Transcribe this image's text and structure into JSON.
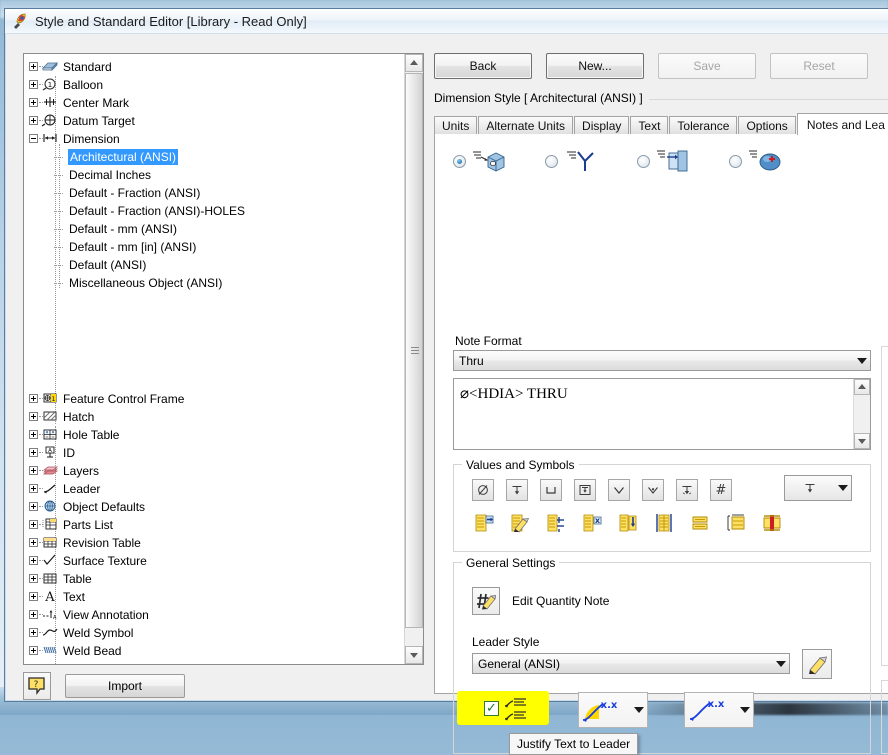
{
  "window": {
    "title": "Style and Standard Editor [Library - Read Only]",
    "icon": "style-editor-icon"
  },
  "tree": {
    "roots": [
      {
        "label": "Standard",
        "icon": "standard-book-icon",
        "expanded": false
      },
      {
        "label": "Balloon",
        "icon": "balloon-icon",
        "expanded": false
      },
      {
        "label": "Center Mark",
        "icon": "center-mark-icon",
        "expanded": false
      },
      {
        "label": "Datum Target",
        "icon": "datum-target-icon",
        "expanded": false
      },
      {
        "label": "Dimension",
        "icon": "dimension-icon",
        "expanded": true
      }
    ],
    "dimension_children": [
      {
        "label": "Architectural (ANSI)",
        "selected": true
      },
      {
        "label": "Decimal Inches",
        "selected": false
      },
      {
        "label": "Default - Fraction (ANSI)",
        "selected": false
      },
      {
        "label": "Default - Fraction (ANSI)-HOLES",
        "selected": false
      },
      {
        "label": "Default - mm (ANSI)",
        "selected": false
      },
      {
        "label": "Default - mm [in] (ANSI)",
        "selected": false
      },
      {
        "label": "Default (ANSI)",
        "selected": false
      },
      {
        "label": "Miscellaneous Object (ANSI)",
        "selected": false
      }
    ],
    "roots_lower": [
      {
        "label": "Feature Control Frame",
        "icon": "feature-control-frame-icon"
      },
      {
        "label": "Hatch",
        "icon": "hatch-icon"
      },
      {
        "label": "Hole Table",
        "icon": "hole-table-icon"
      },
      {
        "label": "ID",
        "icon": "id-icon"
      },
      {
        "label": "Layers",
        "icon": "layers-icon"
      },
      {
        "label": "Leader",
        "icon": "leader-icon"
      },
      {
        "label": "Object Defaults",
        "icon": "object-defaults-icon"
      },
      {
        "label": "Parts List",
        "icon": "parts-list-icon"
      },
      {
        "label": "Revision Table",
        "icon": "revision-table-icon"
      },
      {
        "label": "Surface Texture",
        "icon": "surface-texture-icon"
      },
      {
        "label": "Table",
        "icon": "table-icon"
      },
      {
        "label": "Text",
        "icon": "text-icon"
      },
      {
        "label": "View Annotation",
        "icon": "view-annotation-icon"
      },
      {
        "label": "Weld Symbol",
        "icon": "weld-symbol-icon"
      },
      {
        "label": "Weld Bead",
        "icon": "weld-bead-icon"
      }
    ]
  },
  "toolbar": {
    "back_label": "Back",
    "new_label": "New...",
    "save_label": "Save",
    "reset_label": "Reset"
  },
  "style_header": "Dimension Style [ Architectural (ANSI) ]",
  "tabs": [
    {
      "label": "Units",
      "active": false
    },
    {
      "label": "Alternate Units",
      "active": false
    },
    {
      "label": "Display",
      "active": false
    },
    {
      "label": "Text",
      "active": false
    },
    {
      "label": "Tolerance",
      "active": false
    },
    {
      "label": "Options",
      "active": false
    },
    {
      "label": "Notes and Lea",
      "active": true
    }
  ],
  "note_type_radios": [
    {
      "icon": "hole-note-icon",
      "selected": true
    },
    {
      "icon": "chamfer-note-icon",
      "selected": false
    },
    {
      "icon": "punch-note-icon",
      "selected": false
    },
    {
      "icon": "thread-note-icon",
      "selected": false
    }
  ],
  "note_format": {
    "label": "Note Format",
    "selected": "Thru",
    "options": [
      "Thru"
    ],
    "text_value": "⌀<HDIA> THRU"
  },
  "values_and_symbols": {
    "legend": "Values and Symbols",
    "row1": [
      {
        "icon": "diameter-symbol-icon",
        "glyph": "⌀"
      },
      {
        "icon": "depth-symbol-icon",
        "glyph": ""
      },
      {
        "icon": "counterbore-symbol-icon",
        "glyph": "⌴"
      },
      {
        "icon": "deep-box-symbol-icon",
        "glyph": ""
      },
      {
        "icon": "countersink-symbol-icon",
        "glyph": "⌵"
      },
      {
        "icon": "countersink-dot-symbol-icon",
        "glyph": ""
      },
      {
        "icon": "counterdrill-symbol-icon",
        "glyph": ""
      },
      {
        "icon": "number-symbol-icon",
        "glyph": "#"
      }
    ],
    "row1_dropdown": {
      "icon": "depth-symbol-icon"
    },
    "row2": [
      {
        "icon": "value-insert-icon"
      },
      {
        "icon": "value-edit-icon"
      },
      {
        "icon": "value-divide-icon"
      },
      {
        "icon": "value-multiply-icon"
      },
      {
        "icon": "value-arrow-icon"
      },
      {
        "icon": "value-stack-icon"
      },
      {
        "icon": "value-pair-icon"
      },
      {
        "icon": "value-table-icon"
      },
      {
        "icon": "value-highlight-icon"
      }
    ]
  },
  "general_settings": {
    "legend": "General Settings",
    "edit_quantity_note_label": "Edit Quantity Note",
    "edit_quantity_note_icon": "quantity-note-pencil-icon",
    "leader_style_label": "Leader Style",
    "leader_style_selected": "General (ANSI)",
    "leader_style_edit_icon": "pencil-icon",
    "justify_text_to_leader": {
      "checked": true,
      "icon": "justify-text-to-leader-icon",
      "highlight_color": "#ffff00"
    },
    "precision_dropdowns": [
      {
        "icon": "leader-precision-primary-icon",
        "label": "x.x"
      },
      {
        "icon": "leader-precision-alternate-icon",
        "label": "x.x"
      }
    ]
  },
  "tooltip": {
    "text": "Justify Text to Leader"
  },
  "footer": {
    "help_icon": "help-question-icon",
    "import_label": "Import"
  },
  "colors": {
    "selection_blue": "#3399ff",
    "highlight_yellow": "#ffff00",
    "symbol_yellow": "#ffd700",
    "accent_blue": "#2222cc"
  }
}
